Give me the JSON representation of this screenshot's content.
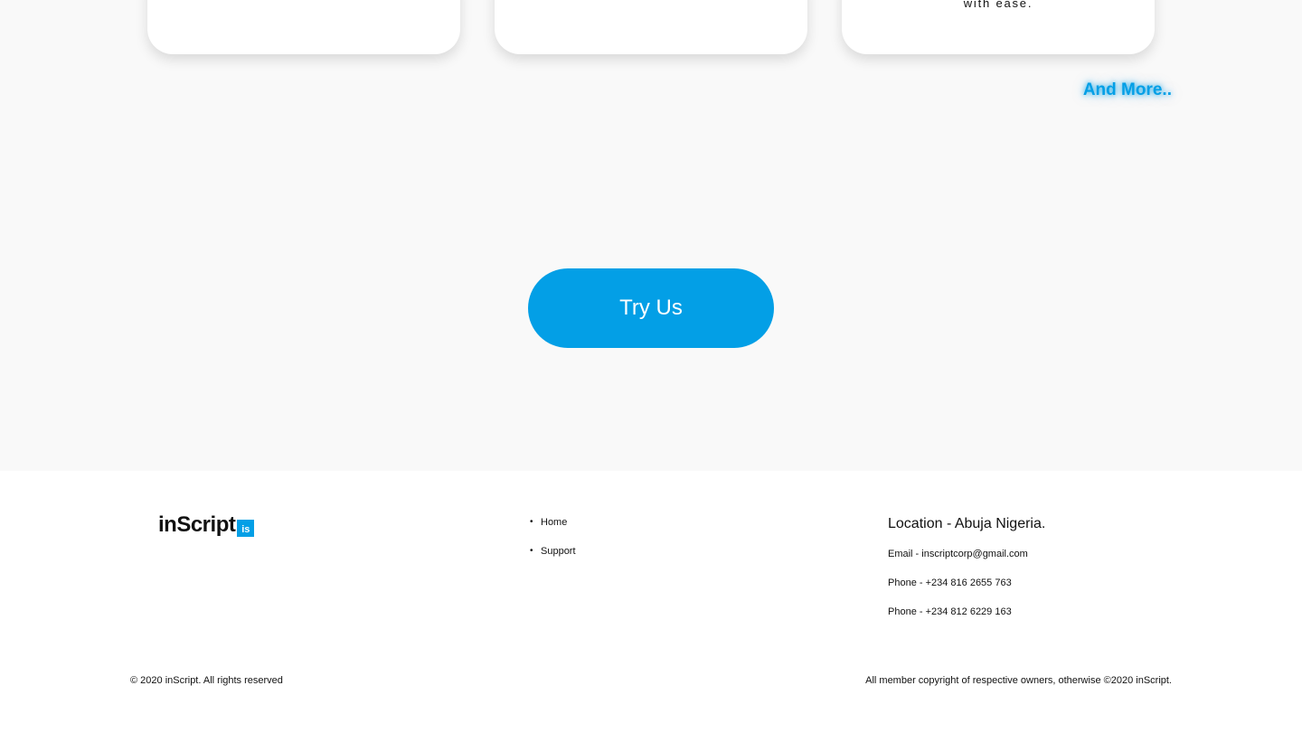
{
  "features": {
    "card3_text": "with ease.",
    "more_label": "And More.."
  },
  "cta": {
    "label": "Try Us"
  },
  "footer": {
    "logo_text": "inScript",
    "logo_badge": "is",
    "nav": [
      {
        "label": "Home"
      },
      {
        "label": "Support"
      }
    ],
    "contact": {
      "location": "Location - Abuja Nigeria.",
      "email": "Email - inscriptcorp@gmail.com",
      "phone1": "Phone - +234 816 2655 763",
      "phone2": "Phone - +234 812 6229 163"
    },
    "copyright_left": "© 2020 inScript. All rights reserved",
    "copyright_right": "All member copyright of respective owners, otherwise ©2020 inScript."
  },
  "colors": {
    "accent": "#039fe6",
    "section_bg": "#f9f9f9"
  }
}
